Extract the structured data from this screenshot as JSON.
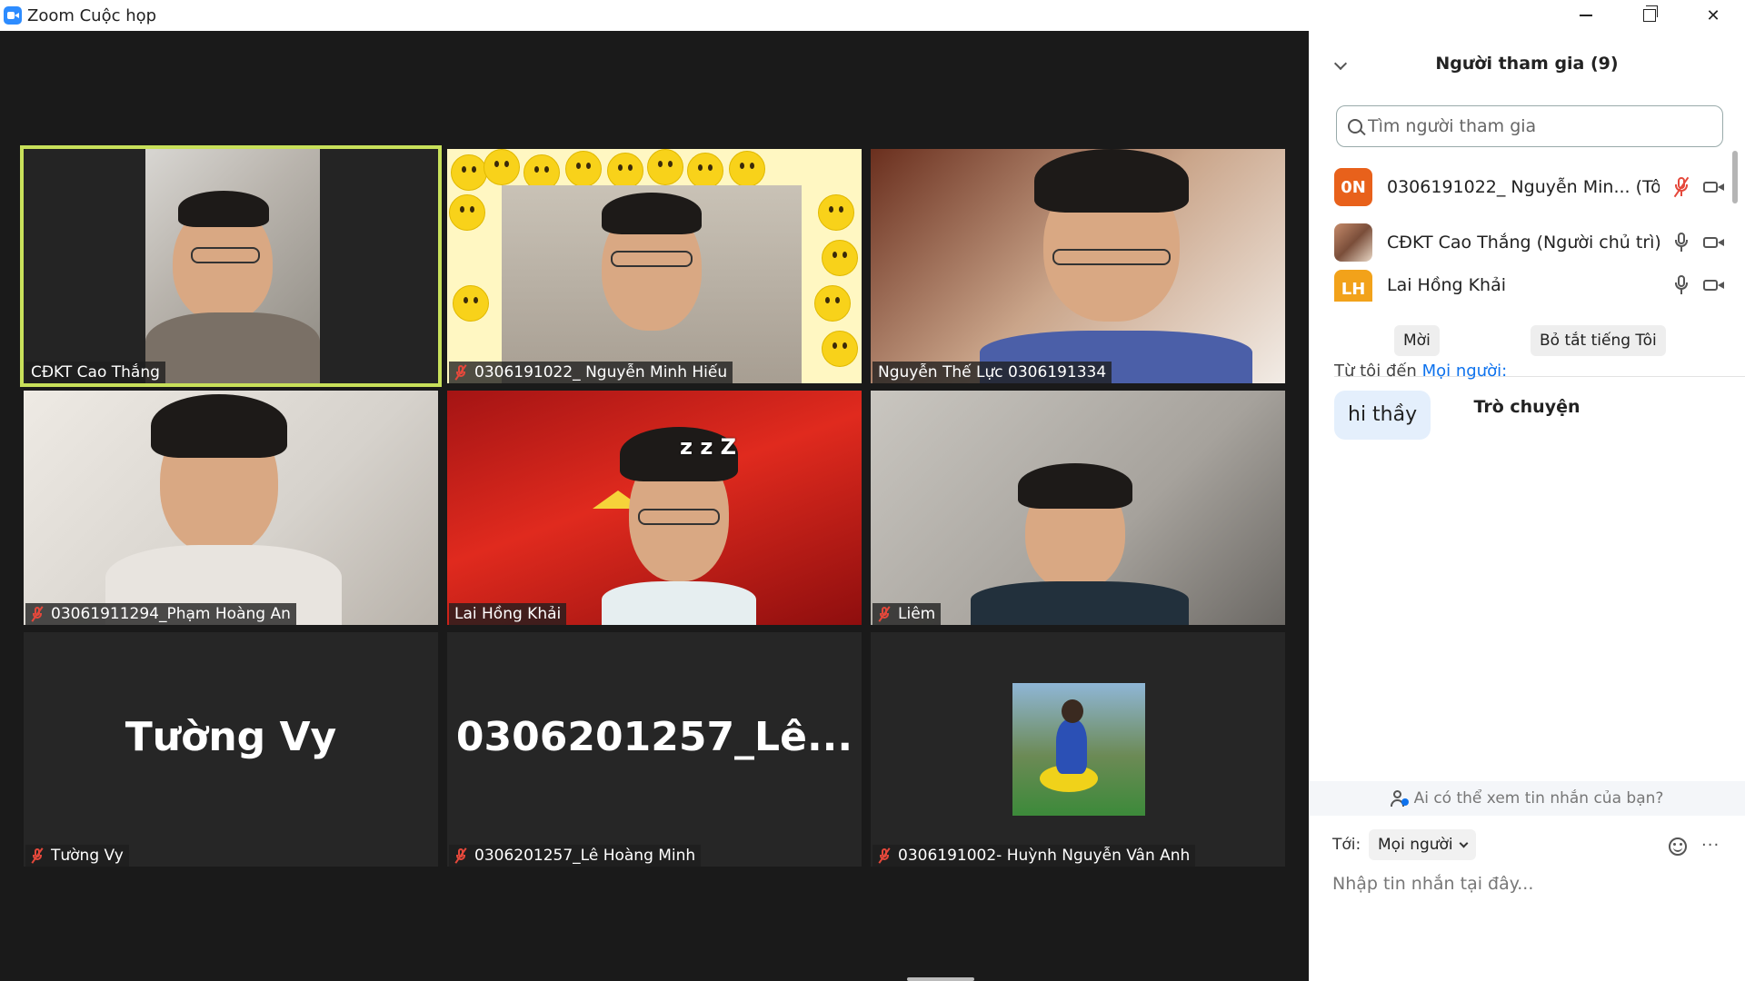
{
  "window": {
    "title": "Zoom Cuộc họp"
  },
  "tiles": [
    {
      "label": "CĐKT Cao Thắng",
      "muted": false,
      "active": true
    },
    {
      "label": "0306191022_ Nguyễn Minh Hiếu",
      "muted": true
    },
    {
      "label": "Nguyễn Thế Lực 0306191334",
      "muted": false
    },
    {
      "label": "03061911294_Phạm Hoàng An",
      "muted": true
    },
    {
      "label": "Lai Hồng Khải",
      "muted": false,
      "overlay_text": "z z Z"
    },
    {
      "label": "Liêm",
      "muted": true
    },
    {
      "label": "Tường Vy",
      "muted": true,
      "big_name": "Tường Vy"
    },
    {
      "label": "0306201257_Lê Hoàng Minh",
      "muted": true,
      "big_name": "0306201257_Lê..."
    },
    {
      "label": "0306191002- Huỳnh Nguyễn Vân Anh",
      "muted": true
    }
  ],
  "participants_panel": {
    "title": "Người tham gia (9)",
    "search_placeholder": "Tìm người tham gia",
    "participants": [
      {
        "avatar_text": "0N",
        "avatar_color": "#e8611b",
        "name": "0306191022_ Nguyễn Min...",
        "tag": "(Tôi)",
        "mic": "muted",
        "camera": "on"
      },
      {
        "avatar_text": "",
        "avatar_color": "photo",
        "name": "CĐKT Cao Thắng (Người chủ trì)",
        "tag": "",
        "mic": "on",
        "camera": "on"
      },
      {
        "avatar_text": "LH",
        "avatar_color": "#f2a21a",
        "name": "Lai Hồng Khải",
        "tag": "",
        "mic": "on",
        "camera": "on"
      }
    ],
    "invite_label": "Mời",
    "mute_me_label": "Bỏ tắt tiếng Tôi"
  },
  "chat_panel": {
    "title": "Trò chuyện",
    "from_prefix": "Từ tôi đến",
    "from_target": "Mọi người",
    "from_suffix": ":",
    "messages": [
      {
        "text": "hi thầy"
      }
    ],
    "privacy_text": "Ai có thể xem tin nhắn của bạn?",
    "to_label": "Tới:",
    "to_value": "Mọi người",
    "input_placeholder": "Nhập tin nhắn tại đây...",
    "more_label": "···"
  },
  "colors": {
    "active_speaker": "#c8e05a",
    "muted_red": "#e5483b",
    "link_blue": "#0e72ed",
    "video_bg": "#1a1a1a",
    "tile_bg": "#262626"
  }
}
